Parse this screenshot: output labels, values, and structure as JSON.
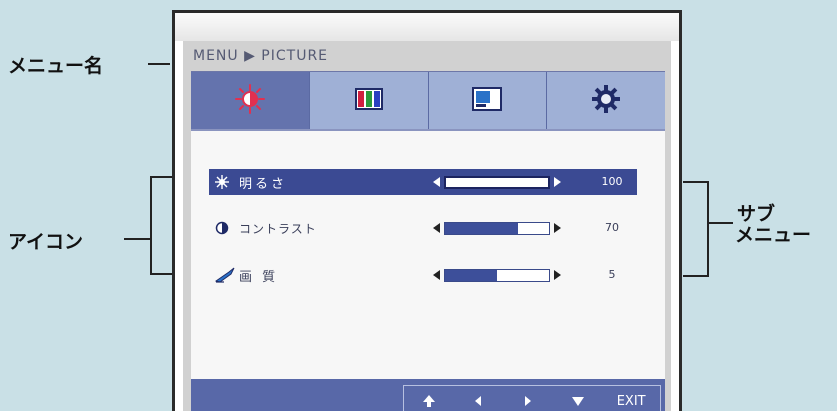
{
  "callouts": {
    "menu_name": "メニュー名",
    "icons": "アイコン",
    "submenu_line1": "サブ",
    "submenu_line2": "メニュー"
  },
  "osd": {
    "breadcrumb": "MENU ▶ PICTURE",
    "tabs": [
      {
        "name": "brightness-tab",
        "icon": "brightness-contrast-icon",
        "active": true
      },
      {
        "name": "color-tab",
        "icon": "color-bars-icon",
        "active": false
      },
      {
        "name": "position-tab",
        "icon": "screen-position-icon",
        "active": false
      },
      {
        "name": "setup-tab",
        "icon": "gear-icon",
        "active": false
      }
    ],
    "items": [
      {
        "label": "明るさ",
        "icon": "sun-icon",
        "value": "100",
        "level": 1.0,
        "selected": true
      },
      {
        "label": "コントラスト",
        "icon": "contrast-icon",
        "value": "70",
        "level": 0.7,
        "selected": false
      },
      {
        "label": "画 質",
        "icon": "sharpness-icon",
        "value": "5",
        "level": 0.5,
        "selected": false
      }
    ],
    "footer": {
      "up_icon": "up-arrow-icon",
      "left_icon": "left-arrow-icon",
      "right_icon": "right-arrow-icon",
      "down_icon": "down-arrow-icon",
      "exit_label": "EXIT"
    }
  },
  "colors": {
    "background": "#c9e0e6",
    "selected_row": "#3b4a93",
    "tab_active": "#6473ad",
    "tab_inactive": "#9fb0d6",
    "footer": "#5868a8"
  }
}
